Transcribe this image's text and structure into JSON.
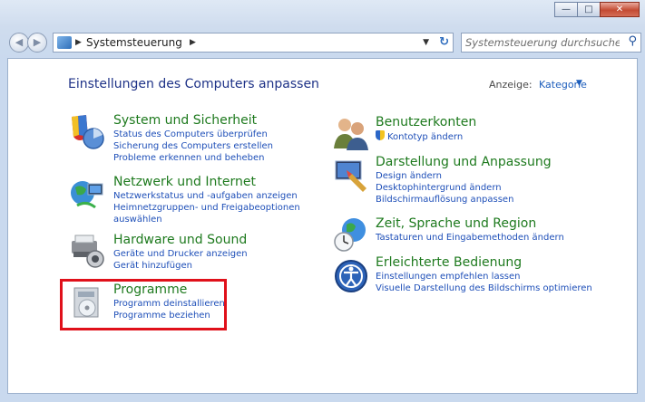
{
  "window": {
    "caption_buttons": {
      "minimize": "—",
      "maximize": "□",
      "close": "✕"
    }
  },
  "addressbar": {
    "breadcrumb": "Systemsteuerung",
    "search_placeholder": "Systemsteuerung durchsuchen"
  },
  "main": {
    "title": "Einstellungen des Computers anpassen",
    "view_label": "Anzeige:",
    "view_value": "Kategorie"
  },
  "categories_left": [
    {
      "title": "System und Sicherheit",
      "links": [
        "Status des Computers überprüfen",
        "Sicherung des Computers erstellen",
        "Probleme erkennen und beheben"
      ]
    },
    {
      "title": "Netzwerk und Internet",
      "links": [
        "Netzwerkstatus und -aufgaben anzeigen",
        "Heimnetzgruppen- und Freigabeoptionen",
        "auswählen"
      ]
    },
    {
      "title": "Hardware und Sound",
      "links": [
        "Geräte und Drucker anzeigen",
        "Gerät hinzufügen"
      ]
    },
    {
      "title": "Programme",
      "links": [
        "Programm deinstallieren",
        "Programme beziehen"
      ]
    }
  ],
  "categories_right": [
    {
      "title": "Benutzerkonten",
      "links": [
        "Kontotyp ändern"
      ]
    },
    {
      "title": "Darstellung und Anpassung",
      "links": [
        "Design ändern",
        "Desktophintergrund ändern",
        "Bildschirmauflösung anpassen"
      ]
    },
    {
      "title": "Zeit, Sprache und Region",
      "links": [
        "Tastaturen und Eingabemethoden ändern"
      ]
    },
    {
      "title": "Erleichterte Bedienung",
      "links": [
        "Einstellungen empfehlen lassen",
        "Visuelle Darstellung des Bildschirms optimieren"
      ]
    }
  ],
  "colors": {
    "category_title": "#1e7a1e",
    "link": "#1e4fb8",
    "highlight_border": "#e0101a",
    "title_text": "#1e3287"
  },
  "icons": [
    "back-icon",
    "forward-icon",
    "control-panel-icon",
    "refresh-icon",
    "search-icon",
    "system-security-icon",
    "network-icon",
    "hardware-sound-icon",
    "programs-icon",
    "user-accounts-icon",
    "appearance-icon",
    "clock-language-icon",
    "ease-of-access-icon",
    "uac-shield-icon"
  ]
}
